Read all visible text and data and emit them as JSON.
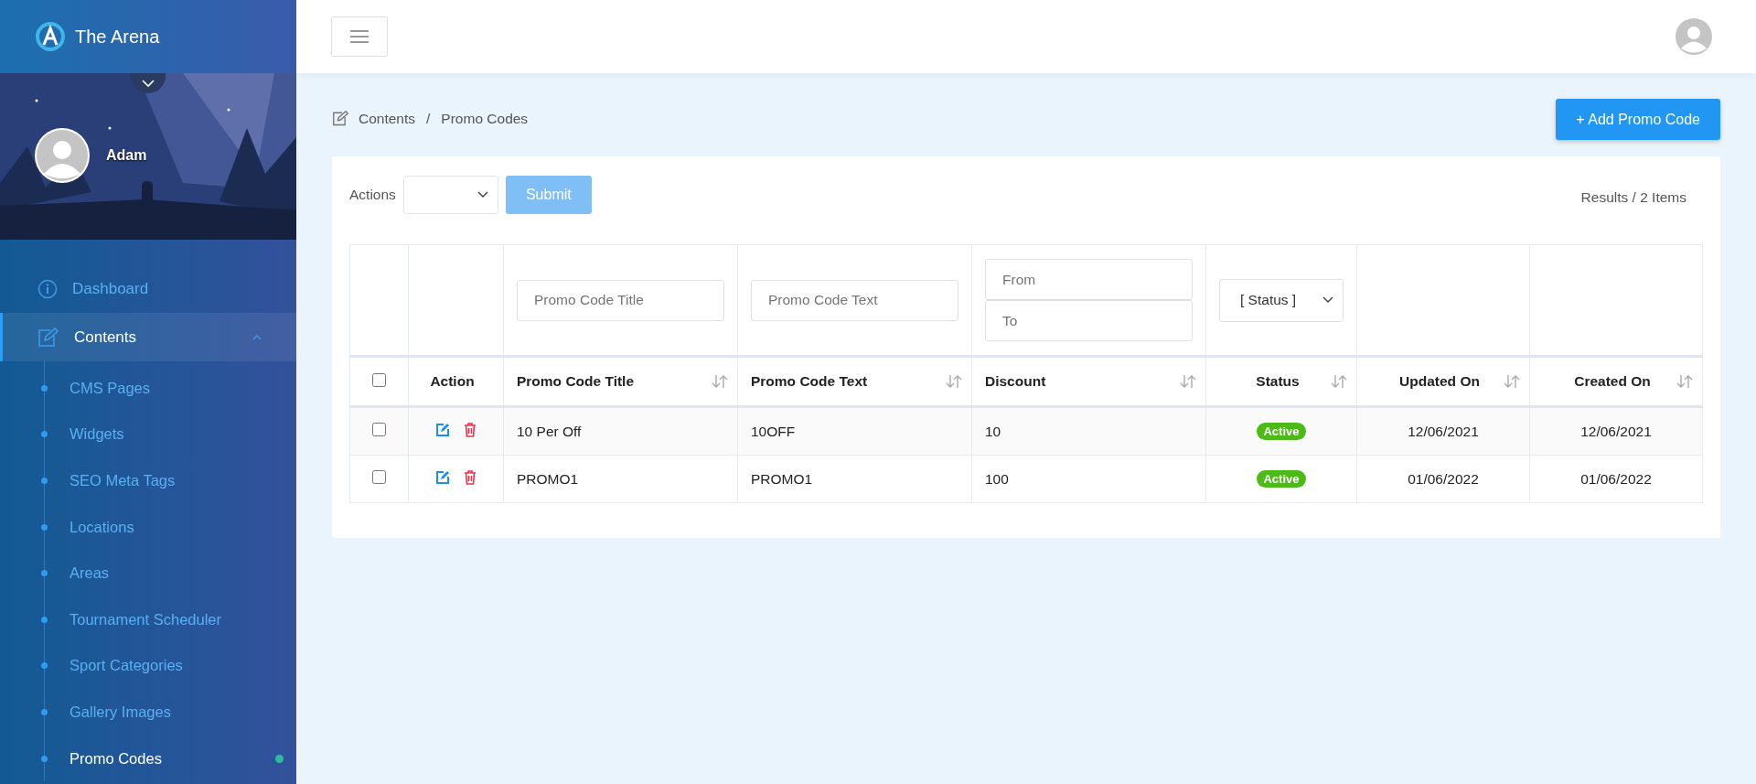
{
  "brand": {
    "name": "The Arena"
  },
  "profile": {
    "name": "Adam"
  },
  "sidebar": {
    "items": [
      {
        "label": "Dashboard",
        "selected": false
      },
      {
        "label": "Contents",
        "selected": true,
        "expanded": true,
        "children": [
          {
            "label": "CMS Pages",
            "selected": false
          },
          {
            "label": "Widgets",
            "selected": false
          },
          {
            "label": "SEO Meta Tags",
            "selected": false
          },
          {
            "label": "Locations",
            "selected": false
          },
          {
            "label": "Areas",
            "selected": false
          },
          {
            "label": "Tournament Scheduler",
            "selected": false
          },
          {
            "label": "Sport Categories",
            "selected": false
          },
          {
            "label": "Gallery Images",
            "selected": false
          },
          {
            "label": "Promo Codes",
            "selected": true
          }
        ]
      }
    ]
  },
  "breadcrumb": {
    "items": [
      "Contents",
      "Promo Codes"
    ],
    "separator": "/"
  },
  "add_button": "+ Add Promo Code",
  "actions": {
    "label": "Actions",
    "submit": "Submit",
    "submit_disabled": true
  },
  "results": "Results / 2 Items",
  "filters": {
    "title": {
      "placeholder": "Promo Code Title"
    },
    "text": {
      "placeholder": "Promo Code Text"
    },
    "from": {
      "placeholder": "From"
    },
    "to": {
      "placeholder": "To"
    },
    "status": "[ Status ]"
  },
  "table": {
    "select_all": false,
    "columns": [
      {
        "label": "Action",
        "sortable": false
      },
      {
        "label": "Promo Code Title",
        "sortable": true
      },
      {
        "label": "Promo Code Text",
        "sortable": true
      },
      {
        "label": "Discount",
        "sortable": true
      },
      {
        "label": "Status",
        "sortable": true
      },
      {
        "label": "Updated On",
        "sortable": true
      },
      {
        "label": "Created On",
        "sortable": true
      }
    ],
    "rows": [
      {
        "checked": false,
        "title": "10 Per Off",
        "text": "10OFF",
        "discount": "10",
        "status": "Active",
        "updated": "12/06/2021",
        "created": "12/06/2021"
      },
      {
        "checked": false,
        "title": "PROMO1",
        "text": "PROMO1",
        "discount": "100",
        "status": "Active",
        "updated": "01/06/2022",
        "created": "01/06/2022"
      }
    ]
  }
}
